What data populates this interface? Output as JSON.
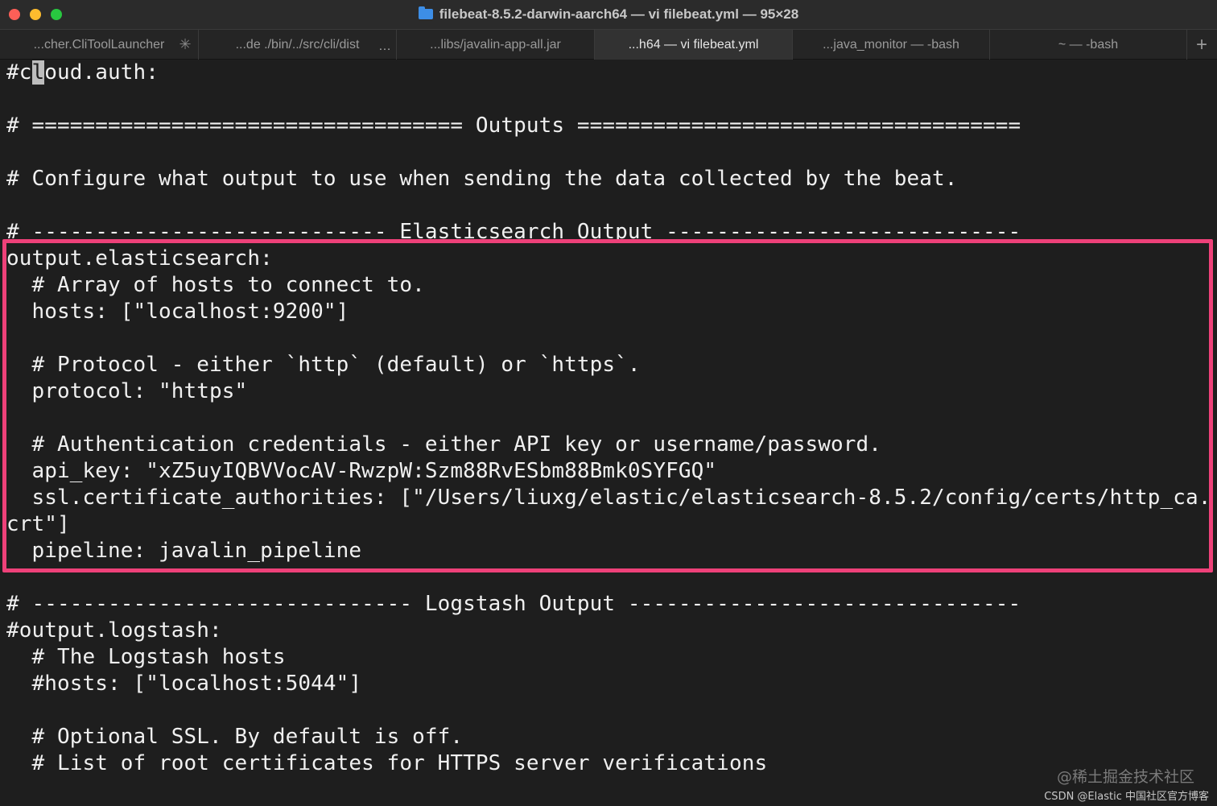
{
  "window": {
    "title": "filebeat-8.5.2-darwin-aarch64 — vi filebeat.yml — 95×28",
    "colors": {
      "background": "#1e1e1e",
      "highlight_border": "#ee4179",
      "close": "#fe5f57",
      "minimize": "#febc2e",
      "maximize": "#28c840"
    }
  },
  "tabs": [
    {
      "label": "...cher.CliToolLauncher",
      "icon": "spinner-icon"
    },
    {
      "label": "...de ./bin/../src/cli/dist",
      "icon": "more-icon"
    },
    {
      "label": "...libs/javalin-app-all.jar"
    },
    {
      "label": "...h64 — vi filebeat.yml",
      "active": true
    },
    {
      "label": "...java_monitor — -bash"
    },
    {
      "label": "~ — -bash"
    }
  ],
  "add_tab": "+",
  "editor": {
    "first_line": {
      "before": "#c",
      "cursor": "l",
      "after": "oud.auth:"
    },
    "lines": [
      "",
      "# ================================== Outputs ===================================",
      "",
      "# Configure what output to use when sending the data collected by the beat.",
      "",
      "# ---------------------------- Elasticsearch Output ----------------------------",
      "output.elasticsearch:",
      "  # Array of hosts to connect to.",
      "  hosts: [\"localhost:9200\"]",
      "",
      "  # Protocol - either `http` (default) or `https`.",
      "  protocol: \"https\"",
      "",
      "  # Authentication credentials - either API key or username/password.",
      "  api_key: \"xZ5uyIQBVVocAV-RwzpW:Szm88RvESbm88Bmk0SYFGQ\"",
      "  ssl.certificate_authorities: [\"/Users/liuxg/elastic/elasticsearch-8.5.2/config/certs/http_ca.",
      "crt\"]",
      "  pipeline: javalin_pipeline",
      "",
      "# ------------------------------ Logstash Output -------------------------------",
      "#output.logstash:",
      "  # The Logstash hosts",
      "  #hosts: [\"localhost:5044\"]",
      "",
      "  # Optional SSL. By default is off.",
      "  # List of root certificates for HTTPS server verifications"
    ]
  },
  "watermark": {
    "line1": "@稀土掘金技术社区",
    "line2": "CSDN @Elastic 中国社区官方博客"
  }
}
